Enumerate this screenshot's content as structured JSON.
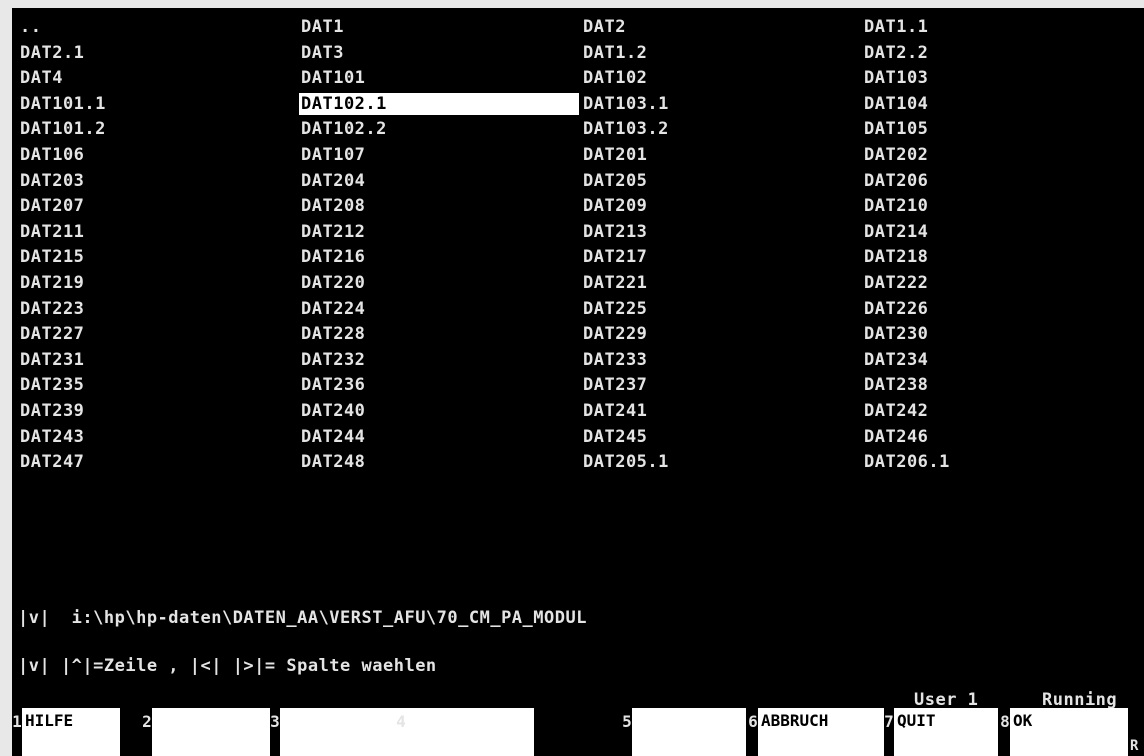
{
  "files": [
    [
      "..",
      "DAT1",
      "DAT2",
      "DAT1.1"
    ],
    [
      "DAT2.1",
      "DAT3",
      "DAT1.2",
      "DAT2.2"
    ],
    [
      "DAT4",
      "DAT101",
      "DAT102",
      "DAT103"
    ],
    [
      "DAT101.1",
      "DAT102.1",
      "DAT103.1",
      "DAT104"
    ],
    [
      "DAT101.2",
      "DAT102.2",
      "DAT103.2",
      "DAT105"
    ],
    [
      "DAT106",
      "DAT107",
      "DAT201",
      "DAT202"
    ],
    [
      "DAT203",
      "DAT204",
      "DAT205",
      "DAT206"
    ],
    [
      "DAT207",
      "DAT208",
      "DAT209",
      "DAT210"
    ],
    [
      "DAT211",
      "DAT212",
      "DAT213",
      "DAT214"
    ],
    [
      "DAT215",
      "DAT216",
      "DAT217",
      "DAT218"
    ],
    [
      "DAT219",
      "DAT220",
      "DAT221",
      "DAT222"
    ],
    [
      "DAT223",
      "DAT224",
      "DAT225",
      "DAT226"
    ],
    [
      "DAT227",
      "DAT228",
      "DAT229",
      "DAT230"
    ],
    [
      "DAT231",
      "DAT232",
      "DAT233",
      "DAT234"
    ],
    [
      "DAT235",
      "DAT236",
      "DAT237",
      "DAT238"
    ],
    [
      "DAT239",
      "DAT240",
      "DAT241",
      "DAT242"
    ],
    [
      "DAT243",
      "DAT244",
      "DAT245",
      "DAT246"
    ],
    [
      "DAT247",
      "DAT248",
      "DAT205.1",
      "DAT206.1"
    ]
  ],
  "selected_file": "DAT102.1",
  "path_line": "|v|  i:\\hp\\hp-daten\\DATEN_AA\\VERST_AFU\\70_CM_PA_MODUL",
  "help_line": "|v| |^|=Zeile , |<| |>|= Spalte waehlen",
  "status": {
    "user": "User 1",
    "state": "Running"
  },
  "function_keys": [
    {
      "num": "1",
      "label": "HILFE"
    },
    {
      "num": "2",
      "label": ""
    },
    {
      "num": "3",
      "label": ""
    },
    {
      "num": "4",
      "label": ""
    },
    {
      "num": "5",
      "label": ""
    },
    {
      "num": "6",
      "label": "ABBRUCH"
    },
    {
      "num": "7",
      "label": "QUIT"
    },
    {
      "num": "8",
      "label": "OK"
    }
  ],
  "corner_mark": "R",
  "colors": {
    "background": "#000000",
    "text": "#e4e4e4",
    "highlight": "#ffffff"
  }
}
